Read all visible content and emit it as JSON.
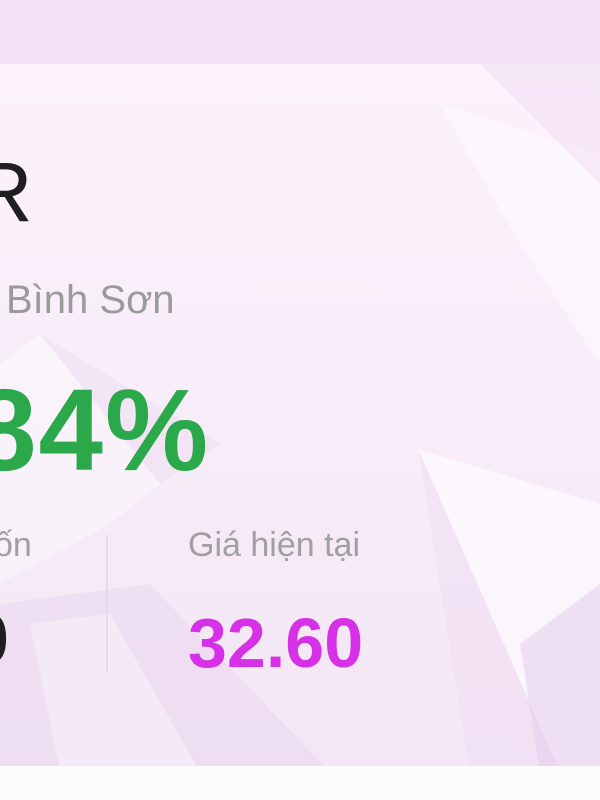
{
  "holding": {
    "ticker_fragment": "R",
    "company_name_fragment": "Bình Sơn",
    "change_percent_fragment": "84%",
    "cost_label_fragment": "ốn",
    "cost_value_fragment": "0",
    "current_price_label": "Giá hiện tại",
    "current_price_value": "32.60"
  },
  "colors": {
    "positive_change": "#2aa84a",
    "current_price": "#d631e6",
    "muted_label": "#a0a0a0",
    "primary_text": "#1f1f1f",
    "background": "#f3e3f5"
  }
}
